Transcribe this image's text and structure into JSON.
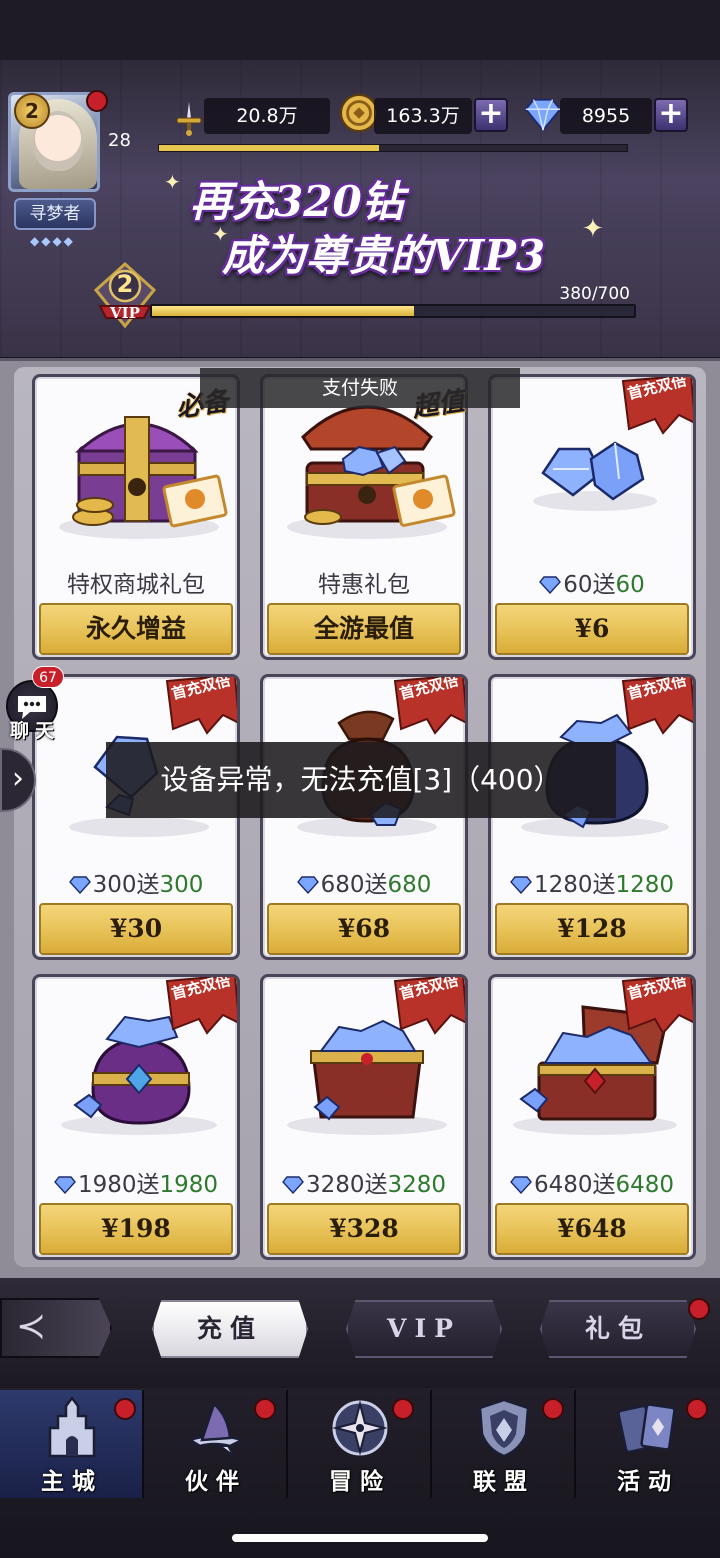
{
  "player": {
    "level": "2",
    "user_level": "28",
    "title": "寻梦者",
    "title_gems": "◆◆◆◆"
  },
  "resources": {
    "power": "20.8万",
    "gold": "163.3万",
    "diamonds": "8955"
  },
  "exp_progress": 0.47,
  "promo": {
    "line1": "再充320钻",
    "line2": "成为尊贵的VIP3"
  },
  "vip": {
    "level": "2",
    "label": "VIP",
    "progress_text": "380/700",
    "progress": 0.543
  },
  "toast_top": "支付失败",
  "toast_main": "设备异常，无法充值[3]（400）",
  "corner_tags": {
    "left": "必备",
    "right": "超值"
  },
  "ribbon_text": "首充双倍",
  "cards": [
    {
      "name": "特权商城礼包",
      "price": "永久增益"
    },
    {
      "name": "特惠礼包",
      "price": "全游最值"
    },
    {
      "base": "60送",
      "bonus": "60",
      "price": "¥6"
    },
    {
      "base": "300送",
      "bonus": "300",
      "price": "¥30"
    },
    {
      "base": "680送",
      "bonus": "680",
      "price": "¥68"
    },
    {
      "base": "1280送",
      "bonus": "1280",
      "price": "¥128"
    },
    {
      "base": "1980送",
      "bonus": "1980",
      "price": "¥198"
    },
    {
      "base": "3280送",
      "bonus": "3280",
      "price": "¥328"
    },
    {
      "base": "6480送",
      "bonus": "6480",
      "price": "¥648"
    }
  ],
  "chat": {
    "count": "67",
    "label": "聊天"
  },
  "tabs": [
    "充值",
    "VIP",
    "礼包"
  ],
  "nav": [
    "主城",
    "伙伴",
    "冒险",
    "联盟",
    "活动"
  ],
  "colors": {
    "accent_gold": "#e8c35a",
    "bonus_green": "#2d7a2d",
    "badge_red": "#c8202a",
    "nav_active": "#2d3a6c"
  }
}
